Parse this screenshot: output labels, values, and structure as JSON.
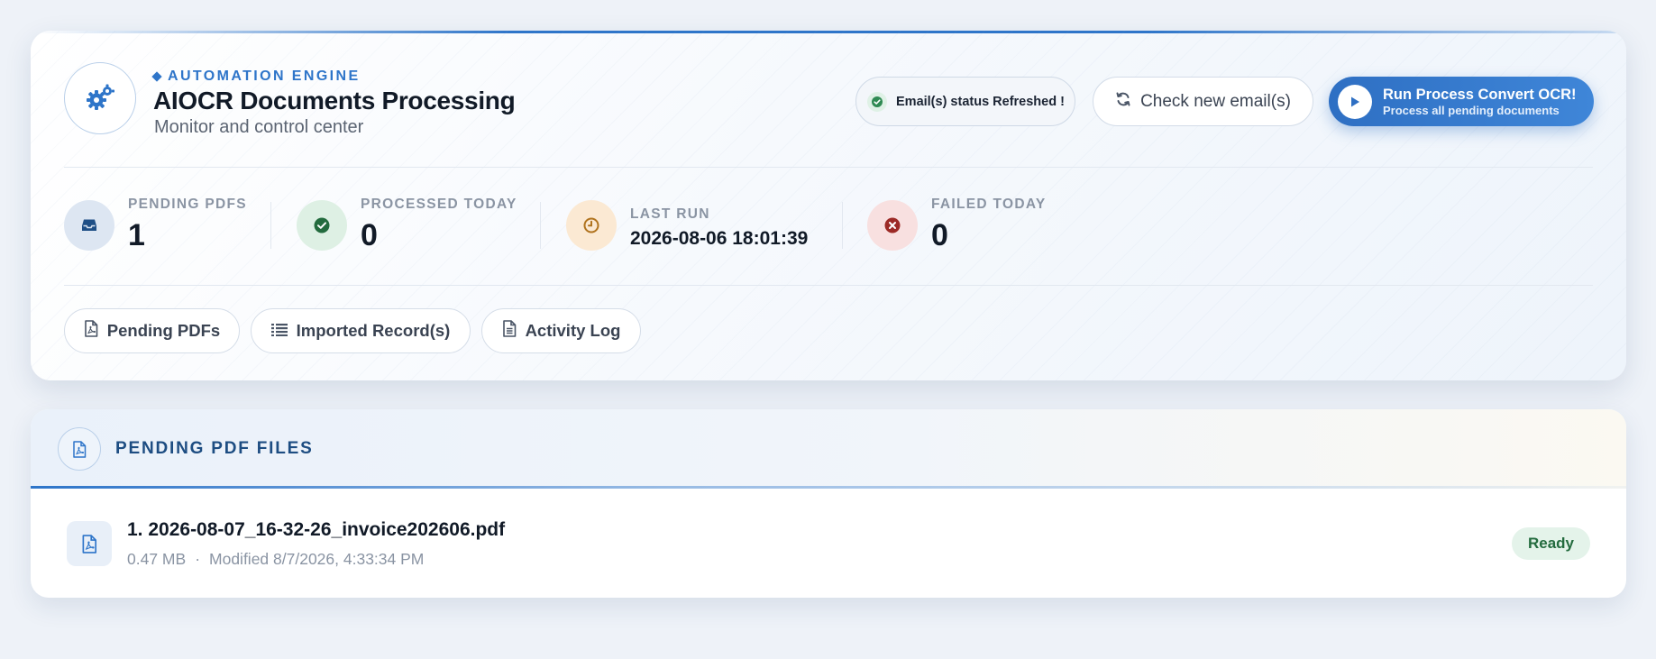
{
  "header": {
    "eyebrow": "AUTOMATION ENGINE",
    "title": "AIOCR Documents Processing",
    "subtitle": "Monitor and control center",
    "status_message": "Email(s) status Refreshed !",
    "check_button": "Check new email(s)",
    "run_button_title": "Run Process Convert OCR!",
    "run_button_subtitle": "Process all pending documents"
  },
  "stats": [
    {
      "label": "PENDING PDFS",
      "value": "1",
      "icon": "inbox-icon",
      "color": "#dde6f2"
    },
    {
      "label": "PROCESSED TODAY",
      "value": "0",
      "icon": "check-circle-icon",
      "color": "#def0e4"
    },
    {
      "label": "LAST RUN",
      "value": "2026-08-06 18:01:39",
      "icon": "clock-icon",
      "color": "#fbe9d3"
    },
    {
      "label": "FAILED TODAY",
      "value": "0",
      "icon": "x-circle-icon",
      "color": "#f8e0e0"
    }
  ],
  "tabs": [
    {
      "label": "Pending PDFs",
      "icon": "pdf-file-icon"
    },
    {
      "label": "Imported Record(s)",
      "icon": "list-icon"
    },
    {
      "label": "Activity Log",
      "icon": "document-icon"
    }
  ],
  "pending_section": {
    "title": "PENDING PDF FILES",
    "files": [
      {
        "name": "1. 2026-08-07_16-32-26_invoice202606.pdf",
        "size": "0.47 MB",
        "separator": "·",
        "modified": "Modified 8/7/2026, 4:33:34 PM",
        "status": "Ready"
      }
    ]
  },
  "colors": {
    "accent": "#2e75c9",
    "success": "#236b3e",
    "danger": "#b3342f",
    "warning": "#c98a2a"
  }
}
